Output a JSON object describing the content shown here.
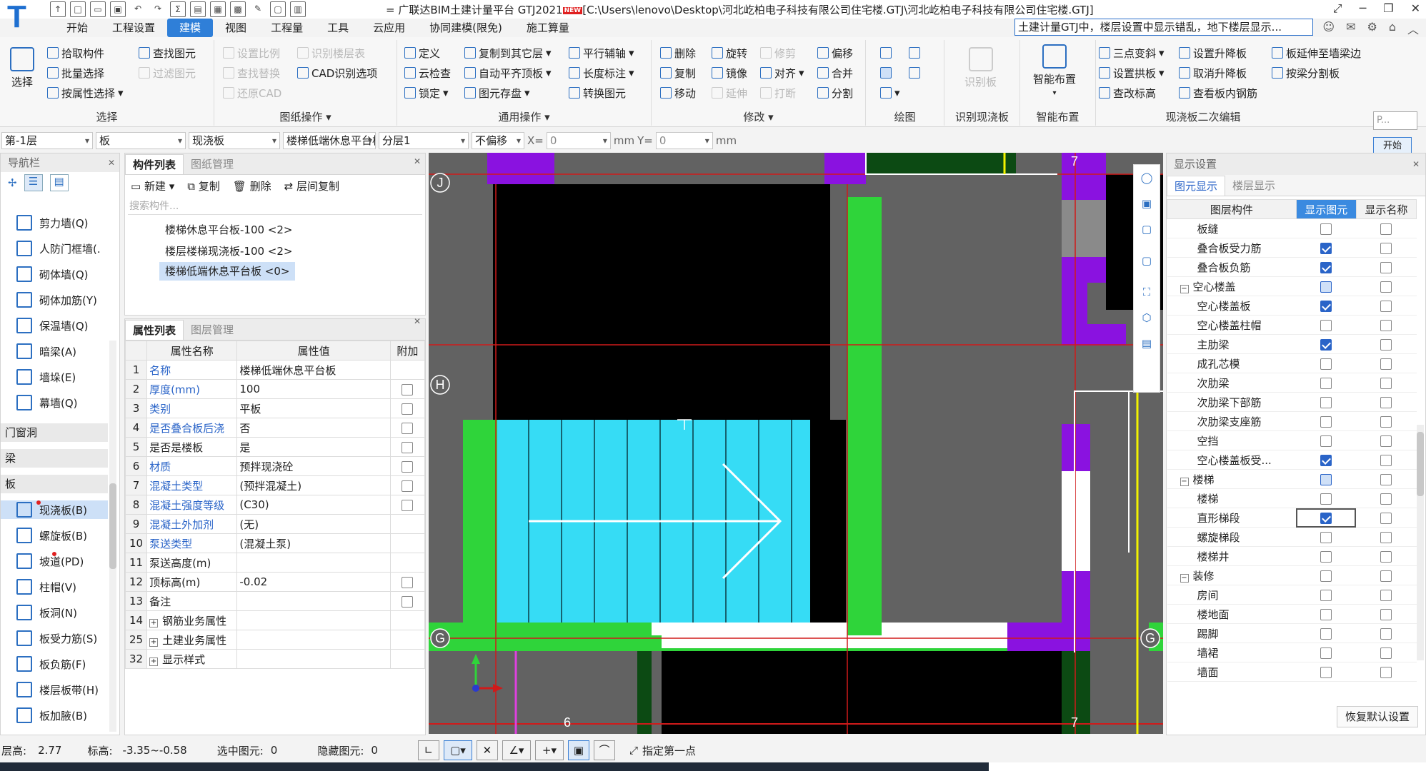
{
  "window": {
    "title": "广联达BIM土建计量平台 GTJ2021",
    "new_badge": "NEW",
    "path": "[C:\\Users\\lenovo\\Desktop\\河北屹柏电子科技有限公司住宅楼.GTJ\\河北屹柏电子科技有限公司住宅楼.GTJ]",
    "search_text": "土建计量GTJ中，楼层设置中显示错乱，地下楼层显示..."
  },
  "menu": {
    "items": [
      "开始",
      "工程设置",
      "建模",
      "视图",
      "工程量",
      "工具",
      "云应用",
      "协同建模(限免)",
      "施工算量"
    ],
    "active": "建模"
  },
  "ribbon": {
    "select": {
      "big": "选择",
      "b1": "拾取构件",
      "b2": "批量选择",
      "b3": "按属性选择",
      "b4": "查找图元",
      "b5": "过滤图元",
      "label": "选择"
    },
    "drawing_ops": {
      "b1": "设置比例",
      "b2": "识别楼层表",
      "b3": "查找替换",
      "b4": "CAD识别选项",
      "b5": "还原CAD",
      "label": "图纸操作"
    },
    "general": {
      "b1": "定义",
      "b2": "复制到其它层",
      "b3": "平行辅轴",
      "b4": "云检查",
      "b5": "自动平齐顶板",
      "b6": "长度标注",
      "b7": "锁定",
      "b8": "图元存盘",
      "b9": "转换图元",
      "label": "通用操作"
    },
    "modify": {
      "b1": "删除",
      "b2": "旋转",
      "b3": "修剪",
      "b4": "偏移",
      "b5": "复制",
      "b6": "镜像",
      "b7": "对齐",
      "b8": "合并",
      "b9": "移动",
      "b10": "延伸",
      "b11": "打断",
      "b12": "分割",
      "label": "修改"
    },
    "draw": {
      "label": "绘图"
    },
    "recognize": {
      "big": "识别板",
      "label": "识别现浇板"
    },
    "smart": {
      "big": "智能布置",
      "label": "智能布置"
    },
    "secondary": {
      "b1": "三点变斜",
      "b2": "设置升降板",
      "b3": "板延伸至墙梁边",
      "b4": "设置拱板",
      "b5": "取消升降板",
      "b6": "按梁分割板",
      "b7": "查改标高",
      "b8": "查看板内钢筋",
      "label": "现浇板二次编辑"
    }
  },
  "floating": {
    "p_label": "P...",
    "start_label": "开始"
  },
  "toolbar": {
    "floor": "第-1层",
    "type": "板",
    "subtype": "现浇板",
    "component": "楼梯低端休息平台板",
    "layer": "分层1",
    "offset": "不偏移",
    "x_label": "X=",
    "x_value": "0",
    "mm1": "mm",
    "y_label": "Y=",
    "y_value": "0",
    "mm2": "mm"
  },
  "nav": {
    "title": "导航栏",
    "items": [
      {
        "label": "剪力墙(Q)"
      },
      {
        "label": "人防门框墙(."
      },
      {
        "label": "砌体墙(Q)"
      },
      {
        "label": "砌体加筋(Y)"
      },
      {
        "label": "保温墙(Q)"
      },
      {
        "label": "暗梁(A)"
      },
      {
        "label": "墙垛(E)"
      },
      {
        "label": "幕墙(Q)"
      }
    ],
    "cat1": "门窗洞",
    "cat2": "梁",
    "cat3": "板",
    "items2": [
      {
        "label": "现浇板(B)"
      },
      {
        "label": "螺旋板(B)"
      },
      {
        "label": "坡道(PD)"
      },
      {
        "label": "柱帽(V)"
      },
      {
        "label": "板洞(N)"
      },
      {
        "label": "板受力筋(S)"
      },
      {
        "label": "板负筋(F)"
      },
      {
        "label": "楼层板带(H)"
      },
      {
        "label": "板加腋(B)"
      }
    ]
  },
  "components": {
    "tab1": "构件列表",
    "tab2": "图纸管理",
    "new": "新建",
    "copy": "复制",
    "delete": "删除",
    "floor_copy": "层间复制",
    "search_placeholder": "搜索构件...",
    "items": [
      "楼梯休息平台板-100 <2>",
      "楼层楼梯现浇板-100 <2>",
      "楼梯低端休息平台板 <0>"
    ]
  },
  "props": {
    "tab1": "属性列表",
    "tab2": "图层管理",
    "headers": [
      "属性名称",
      "属性值",
      "附加"
    ],
    "rows": [
      {
        "n": "1",
        "name": "名称",
        "value": "楼梯低端休息平台板",
        "blue": true,
        "cb": false
      },
      {
        "n": "2",
        "name": "厚度(mm)",
        "value": "100",
        "blue": true,
        "cb": true
      },
      {
        "n": "3",
        "name": "类别",
        "value": "平板",
        "blue": true,
        "cb": true
      },
      {
        "n": "4",
        "name": "是否叠合板后浇",
        "value": "否",
        "blue": true,
        "cb": true
      },
      {
        "n": "5",
        "name": "是否是楼板",
        "value": "是",
        "blue": false,
        "cb": true
      },
      {
        "n": "6",
        "name": "材质",
        "value": "预拌现浇砼",
        "blue": true,
        "cb": true
      },
      {
        "n": "7",
        "name": "混凝土类型",
        "value": "(预拌混凝土)",
        "blue": true,
        "cb": true
      },
      {
        "n": "8",
        "name": "混凝土强度等级",
        "value": "(C30)",
        "blue": true,
        "cb": true
      },
      {
        "n": "9",
        "name": "混凝土外加剂",
        "value": "(无)",
        "blue": true,
        "cb": false
      },
      {
        "n": "10",
        "name": "泵送类型",
        "value": "(混凝土泵)",
        "blue": true,
        "cb": false
      },
      {
        "n": "11",
        "name": "泵送高度(m)",
        "value": "",
        "blue": false,
        "cb": false
      },
      {
        "n": "12",
        "name": "顶标高(m)",
        "value": "-0.02",
        "blue": false,
        "cb": true
      },
      {
        "n": "13",
        "name": "备注",
        "value": "",
        "blue": false,
        "cb": true
      },
      {
        "n": "14",
        "name": "钢筋业务属性",
        "value": "",
        "blue": false,
        "cb": false,
        "expand": true
      },
      {
        "n": "25",
        "name": "土建业务属性",
        "value": "",
        "blue": false,
        "cb": false,
        "expand": true
      },
      {
        "n": "32",
        "name": "显示样式",
        "value": "",
        "blue": false,
        "cb": false,
        "expand": true
      }
    ]
  },
  "display": {
    "title": "显示设置",
    "tab1": "图元显示",
    "tab2": "楼层显示",
    "headers": [
      "图层构件",
      "显示图元",
      "显示名称"
    ],
    "rows": [
      {
        "label": "板缝",
        "indent": 2,
        "a": "off",
        "b": "off"
      },
      {
        "label": "叠合板受力筋",
        "indent": 2,
        "a": "on",
        "b": "off"
      },
      {
        "label": "叠合板负筋",
        "indent": 2,
        "a": "on",
        "b": "off"
      },
      {
        "label": "空心楼盖",
        "indent": 1,
        "a": "partial",
        "b": "off",
        "group": true
      },
      {
        "label": "空心楼盖板",
        "indent": 2,
        "a": "on",
        "b": "off"
      },
      {
        "label": "空心楼盖柱帽",
        "indent": 2,
        "a": "off",
        "b": "off"
      },
      {
        "label": "主肋梁",
        "indent": 2,
        "a": "on",
        "b": "off"
      },
      {
        "label": "成孔芯模",
        "indent": 2,
        "a": "off",
        "b": "off"
      },
      {
        "label": "次肋梁",
        "indent": 2,
        "a": "off",
        "b": "off"
      },
      {
        "label": "次肋梁下部筋",
        "indent": 2,
        "a": "off",
        "b": "off"
      },
      {
        "label": "次肋梁支座筋",
        "indent": 2,
        "a": "off",
        "b": "off"
      },
      {
        "label": "空挡",
        "indent": 2,
        "a": "off",
        "b": "off"
      },
      {
        "label": "空心楼盖板受...",
        "indent": 2,
        "a": "on",
        "b": "off"
      },
      {
        "label": "楼梯",
        "indent": 1,
        "a": "partial",
        "b": "off",
        "group": true
      },
      {
        "label": "楼梯",
        "indent": 2,
        "a": "off",
        "b": "off"
      },
      {
        "label": "直形梯段",
        "indent": 2,
        "a": "on",
        "b": "off"
      },
      {
        "label": "螺旋梯段",
        "indent": 2,
        "a": "off",
        "b": "off"
      },
      {
        "label": "楼梯井",
        "indent": 2,
        "a": "off",
        "b": "off"
      },
      {
        "label": "装修",
        "indent": 1,
        "a": "off",
        "b": "off",
        "group": true
      },
      {
        "label": "房间",
        "indent": 2,
        "a": "off",
        "b": "off"
      },
      {
        "label": "楼地面",
        "indent": 2,
        "a": "off",
        "b": "off"
      },
      {
        "label": "踢脚",
        "indent": 2,
        "a": "off",
        "b": "off"
      },
      {
        "label": "墙裙",
        "indent": 2,
        "a": "off",
        "b": "off"
      },
      {
        "label": "墙面",
        "indent": 2,
        "a": "off",
        "b": "off"
      }
    ],
    "restore": "恢复默认设置"
  },
  "canvas": {
    "axis_labels": {
      "J": "J",
      "H": "H",
      "G": "G",
      "H2": "H",
      "G2": "G",
      "n6": "6",
      "n7": "7",
      "n7b": "7"
    },
    "colors": {
      "purple": "#8a12e0",
      "green": "#2fd43a",
      "darkgreen": "#0c4a13",
      "cyan": "#36dcf5",
      "black": "#000000",
      "gray": "#626262",
      "white": "#ffffff",
      "red": "#d01a1a",
      "yellow": "#f3f300",
      "magenta": "#e040e0"
    }
  },
  "status": {
    "floor_h_label": "层高:",
    "floor_h": "2.77",
    "elev_label": "标高:",
    "elev": "-3.35~-0.58",
    "selected_label": "选中图元:",
    "selected": "0",
    "hidden_label": "隐藏图元:",
    "hidden": "0",
    "hint": "指定第一点"
  }
}
